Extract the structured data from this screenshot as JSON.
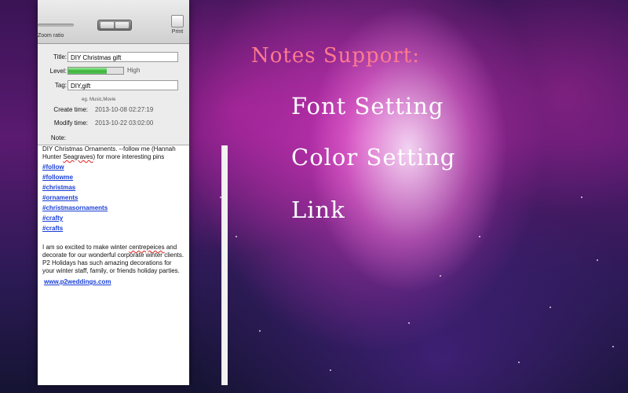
{
  "toolbar": {
    "zoom_label": "Zoom ratio",
    "print_label": "Print"
  },
  "form": {
    "title_label": "Title:",
    "title_value": "DIY Christmas gift",
    "level_label": "Level:",
    "level_value_text": "High",
    "level_fraction": 0.7,
    "tag_label": "Tag:",
    "tag_value": "DIY,gift",
    "tag_hint": "eg. Music,Movie",
    "create_label": "Create time:",
    "create_value": "2013-10-08 02:27:19",
    "modify_label": "Modify time:",
    "modify_value": "2013-10-22 03:02:00",
    "note_label": "Note:"
  },
  "note": {
    "para1_a": "DIY Christmas Ornaments. --follow me (Hannah Hunter ",
    "para1_wavy": "Seagraves",
    "para1_b": ") for more interesting pins",
    "tags": [
      "#follow",
      "#followme",
      "#christmas",
      "#ornaments",
      "#christmasornaments",
      "#crafty",
      "#crafts"
    ],
    "para2_a": "I am so excited to make winter ",
    "para2_wavy": "centrepeices",
    "para2_b": " and decorate for our wonderful corporate winter clients. P2 Holidays has such amazing decorations for your winter staff, family, or friends holiday parties.",
    "link": "www.p2weddings.com"
  },
  "overlay": {
    "title": "Notes Support:",
    "items": [
      "Font Setting",
      "Color Setting",
      "Link"
    ]
  },
  "colors": {
    "overlay_title": "#ff7a8e",
    "link": "#1a3fd6",
    "level_bar": "#3ab43a"
  }
}
